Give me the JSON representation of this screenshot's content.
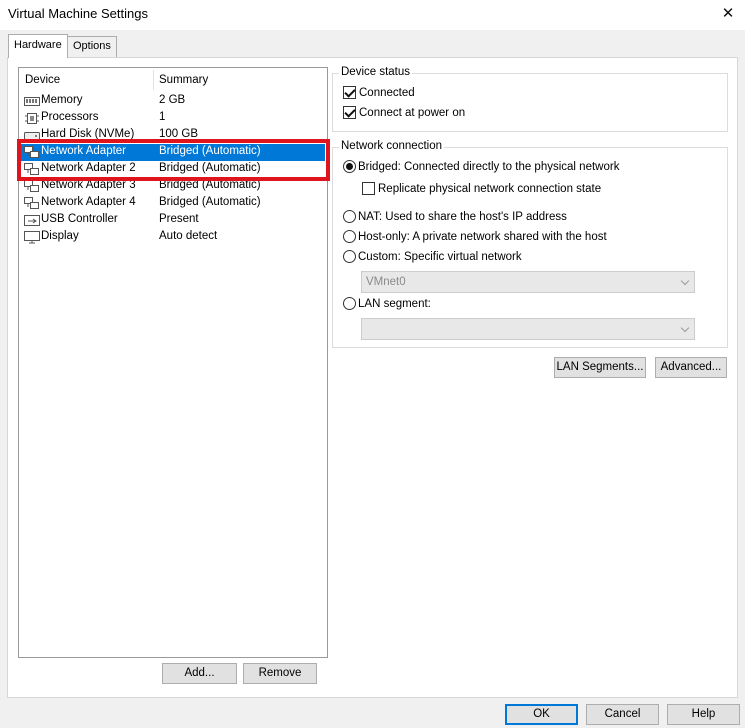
{
  "window": {
    "title": "Virtual Machine Settings",
    "close_glyph": "✕"
  },
  "tabs": [
    {
      "label": "Hardware",
      "active": true
    },
    {
      "label": "Options",
      "active": false
    }
  ],
  "device_list": {
    "columns": {
      "device": "Device",
      "summary": "Summary"
    },
    "rows": [
      {
        "name": "Memory",
        "summary": "2 GB",
        "icon": "memory-icon",
        "selected": false
      },
      {
        "name": "Processors",
        "summary": "1",
        "icon": "processor-icon",
        "selected": false
      },
      {
        "name": "Hard Disk (NVMe)",
        "summary": "100 GB",
        "icon": "hard-disk-icon",
        "selected": false
      },
      {
        "name": "Network Adapter",
        "summary": "Bridged (Automatic)",
        "icon": "network-adapter-icon",
        "selected": true
      },
      {
        "name": "Network Adapter 2",
        "summary": "Bridged (Automatic)",
        "icon": "network-adapter-icon",
        "selected": false
      },
      {
        "name": "Network Adapter 3",
        "summary": "Bridged (Automatic)",
        "icon": "network-adapter-icon",
        "selected": false
      },
      {
        "name": "Network Adapter 4",
        "summary": "Bridged (Automatic)",
        "icon": "network-adapter-icon",
        "selected": false
      },
      {
        "name": "USB Controller",
        "summary": "Present",
        "icon": "usb-icon",
        "selected": false
      },
      {
        "name": "Display",
        "summary": "Auto detect",
        "icon": "display-icon",
        "selected": false
      }
    ],
    "add_label": "Add...",
    "remove_label": "Remove"
  },
  "device_status": {
    "title": "Device status",
    "connected_label": "Connected",
    "connected_checked": true,
    "power_on_label": "Connect at power on",
    "power_on_checked": true
  },
  "network_connection": {
    "title": "Network connection",
    "bridged_label": "Bridged: Connected directly to the physical network",
    "replicate_label": "Replicate physical network connection state",
    "replicate_checked": false,
    "nat_label": "NAT: Used to share the host's IP address",
    "hostonly_label": "Host-only: A private network shared with the host",
    "custom_label": "Custom: Specific virtual network",
    "custom_value": "VMnet0",
    "lan_label": "LAN segment:",
    "lan_value": "",
    "selected": "bridged"
  },
  "panel_buttons": {
    "lan_segments": "LAN Segments...",
    "advanced": "Advanced..."
  },
  "dialog_buttons": {
    "ok": "OK",
    "cancel": "Cancel",
    "help": "Help"
  },
  "colors": {
    "selection": "#0078d7",
    "highlight_box": "#e0141e"
  }
}
